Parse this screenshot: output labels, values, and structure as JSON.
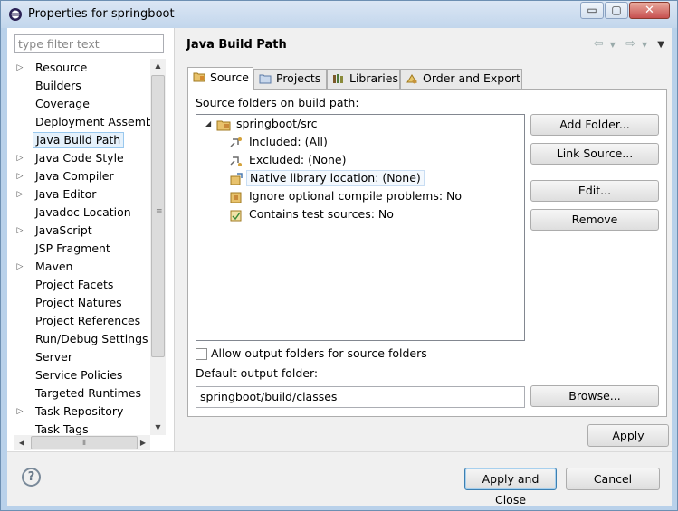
{
  "window": {
    "title": "Properties for springboot",
    "controls": {
      "minimize": "▭",
      "maximize": "▢",
      "close": "✕"
    }
  },
  "sidebar": {
    "filter_placeholder": "type filter text",
    "items": [
      {
        "label": "Resource",
        "expandable": true
      },
      {
        "label": "Builders",
        "expandable": false
      },
      {
        "label": "Coverage",
        "expandable": false
      },
      {
        "label": "Deployment Assembly",
        "expandable": false
      },
      {
        "label": "Java Build Path",
        "expandable": false,
        "selected": true
      },
      {
        "label": "Java Code Style",
        "expandable": true
      },
      {
        "label": "Java Compiler",
        "expandable": true
      },
      {
        "label": "Java Editor",
        "expandable": true
      },
      {
        "label": "Javadoc Location",
        "expandable": false
      },
      {
        "label": "JavaScript",
        "expandable": true
      },
      {
        "label": "JSP Fragment",
        "expandable": false
      },
      {
        "label": "Maven",
        "expandable": true
      },
      {
        "label": "Project Facets",
        "expandable": false
      },
      {
        "label": "Project Natures",
        "expandable": false
      },
      {
        "label": "Project References",
        "expandable": false
      },
      {
        "label": "Run/Debug Settings",
        "expandable": false
      },
      {
        "label": "Server",
        "expandable": false
      },
      {
        "label": "Service Policies",
        "expandable": false
      },
      {
        "label": "Targeted Runtimes",
        "expandable": false
      },
      {
        "label": "Task Repository",
        "expandable": true
      },
      {
        "label": "Task Tags",
        "expandable": false
      }
    ]
  },
  "page": {
    "title": "Java Build Path",
    "tabs": [
      {
        "label": "Source",
        "icon": "source-folder-icon",
        "active": true
      },
      {
        "label": "Projects",
        "icon": "projects-icon",
        "active": false
      },
      {
        "label": "Libraries",
        "icon": "libraries-icon",
        "active": false
      },
      {
        "label": "Order and Export",
        "icon": "order-export-icon",
        "active": false
      }
    ],
    "source_folders_label": "Source folders on build path:",
    "source_tree": {
      "root": "springboot/src",
      "children": [
        "Included: (All)",
        "Excluded: (None)",
        "Native library location: (None)",
        "Ignore optional compile problems: No",
        "Contains test sources: No"
      ]
    },
    "buttons": {
      "add_folder": "Add Folder...",
      "link_source": "Link Source...",
      "edit": "Edit...",
      "remove": "Remove",
      "browse": "Browse...",
      "apply": "Apply"
    },
    "allow_output_label": "Allow output folders for source folders",
    "allow_output_checked": false,
    "default_output_label": "Default output folder:",
    "default_output_value": "springboot/build/classes"
  },
  "footer": {
    "help": "?",
    "apply_and_close": "Apply and Close",
    "cancel": "Cancel"
  }
}
